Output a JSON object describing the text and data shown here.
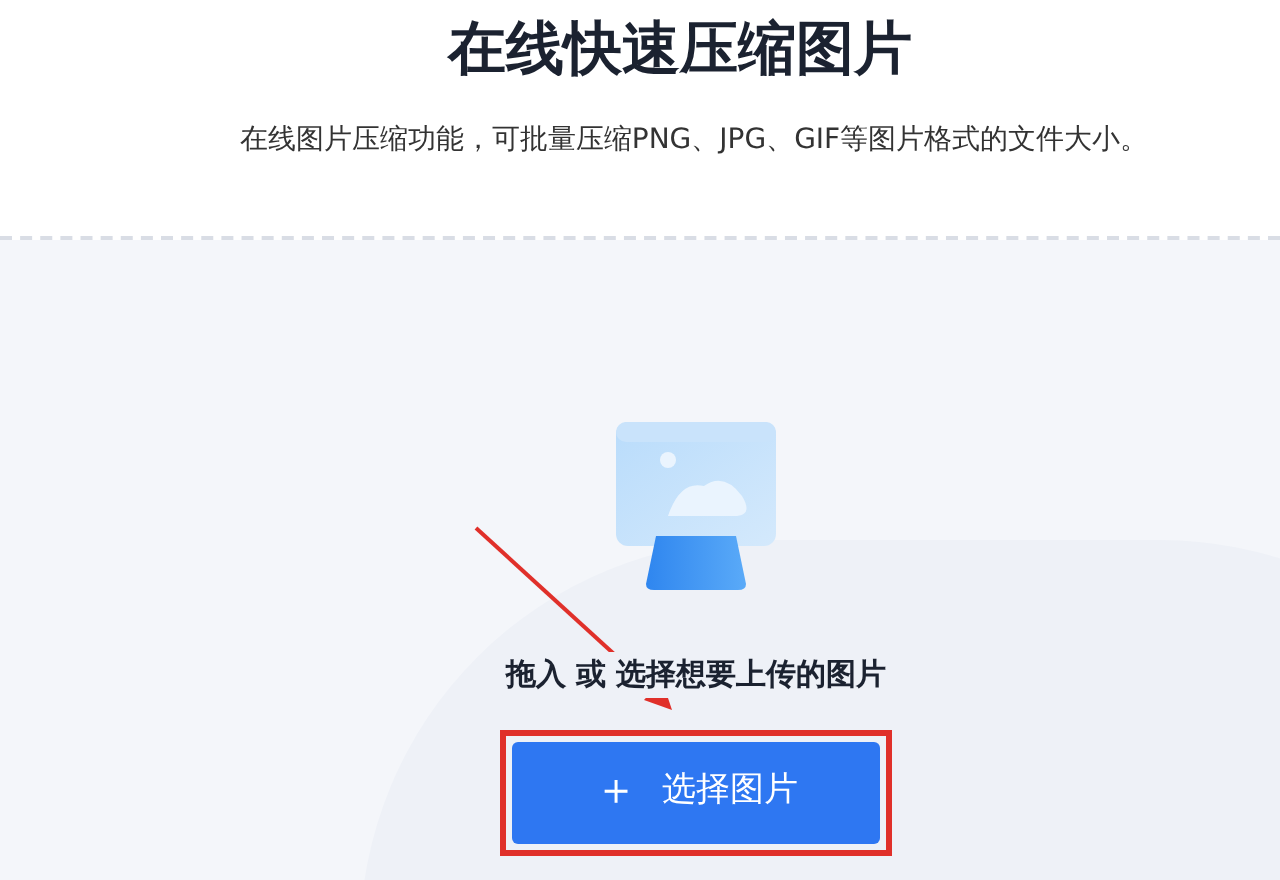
{
  "title": "在线快速压缩图片",
  "subtitle": "在线图片压缩功能，可批量压缩PNG、JPG、GIF等图片格式的文件大小。",
  "upload": {
    "hint": "拖入 或 选择想要上传的图片",
    "button": {
      "icon": "＋",
      "label": "选择图片"
    }
  }
}
